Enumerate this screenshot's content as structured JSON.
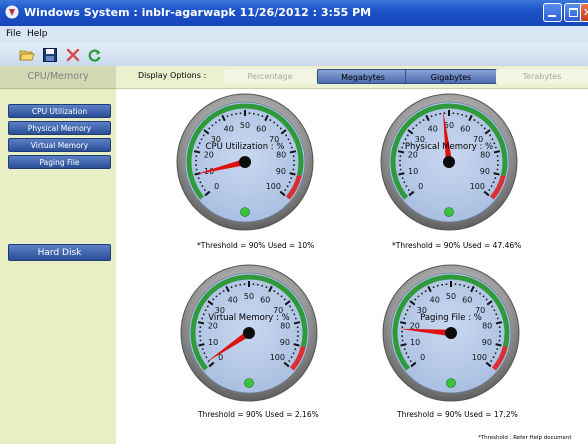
{
  "window": {
    "title": "Windows System : inblr-agarwapk 11/26/2012 : 3:55 PM"
  },
  "menu": [
    "File",
    "Help"
  ],
  "toolbar": {
    "icons": [
      "open-folder-icon",
      "save-icon",
      "delete-icon",
      "refresh-icon"
    ]
  },
  "sidebar": {
    "tab": "CPU/Memory",
    "items": [
      "CPU Utilization",
      "Physical Memory",
      "Virtual Memory",
      "Paging File"
    ],
    "hard_disk": "Hard Disk"
  },
  "display_options": {
    "label": "Display Options :",
    "buttons": [
      {
        "label": "Percentage",
        "active": false
      },
      {
        "label": "Megabytes",
        "active": true
      },
      {
        "label": "Gigabytes",
        "active": true
      },
      {
        "label": "Terabytes",
        "active": false
      }
    ]
  },
  "gauges": [
    {
      "title": "CPU Utilization : %",
      "value": 10,
      "caption": "*Threshold = 90% Used = 10%"
    },
    {
      "title": "Physical Memory : %",
      "value": 47.46,
      "caption": "*Threshold = 90% Used = 47.46%"
    },
    {
      "title": "Virtual Memory : %",
      "value": 2.16,
      "caption": "Threshold = 90% Used = 2.16%"
    },
    {
      "title": "Paging File : %",
      "value": 17.2,
      "caption": "Threshold = 90% Used = 17.2%"
    }
  ],
  "gauge_scale": {
    "min": 0,
    "max": 100,
    "ticks": [
      0,
      10,
      20,
      30,
      40,
      50,
      60,
      70,
      80,
      90,
      100
    ]
  },
  "footnote": "*Threshold : Refer Help document",
  "colors": {
    "titlebar": "#1d54c9",
    "gauge_face": "#a7bde0",
    "needle": "#e01010",
    "green_band": "#2f9a3a",
    "red_band": "#d83030"
  }
}
